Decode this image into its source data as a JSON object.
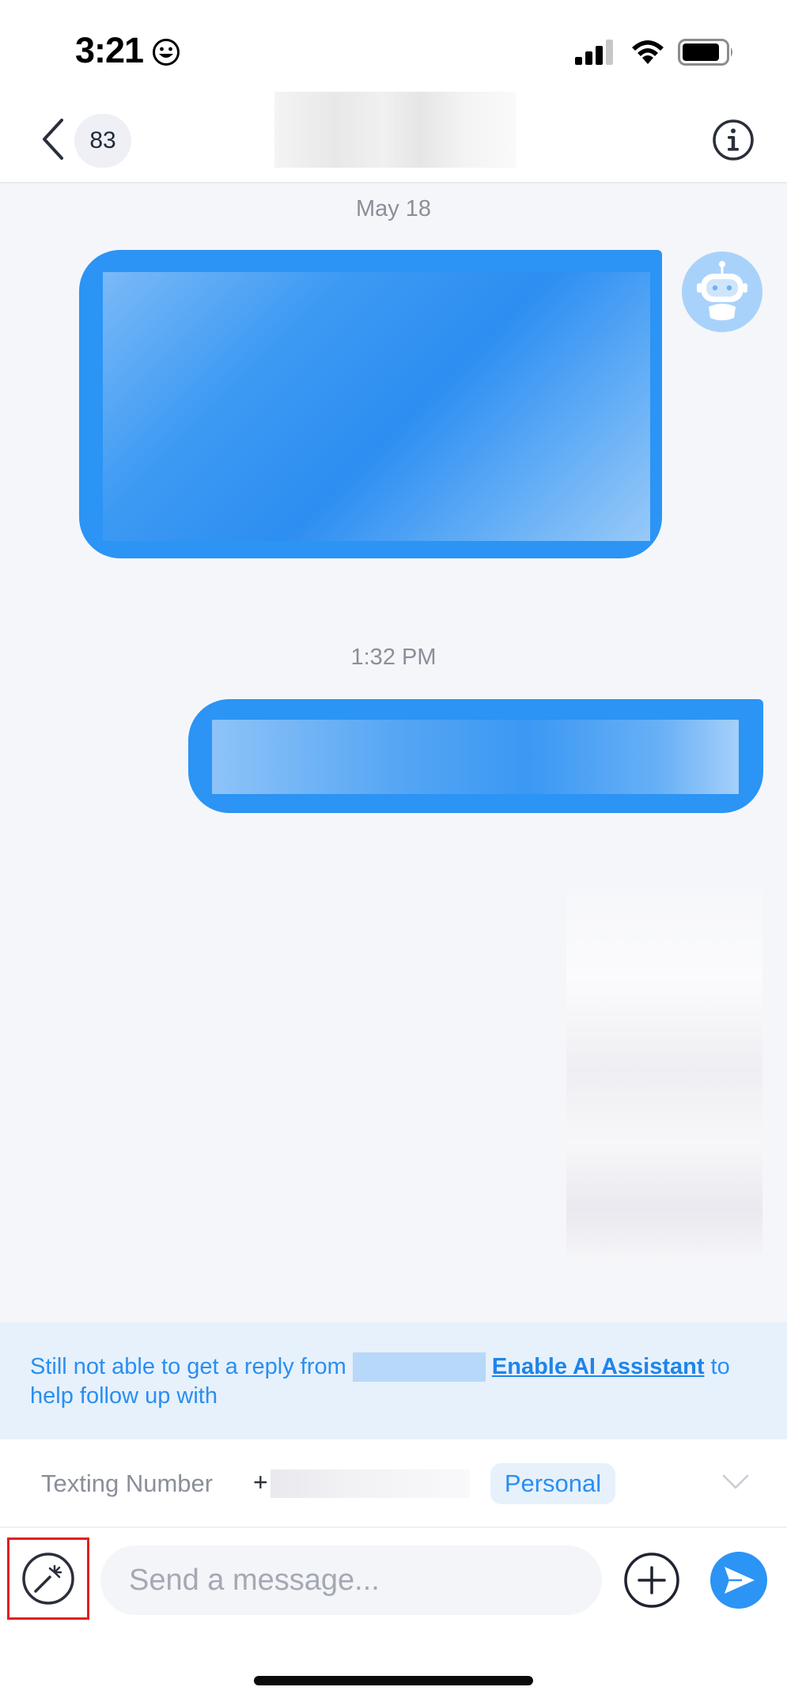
{
  "status_bar": {
    "time": "3:21"
  },
  "header": {
    "unread_count": "83"
  },
  "chat": {
    "date_1": "May 18",
    "date_2": "1:32 PM"
  },
  "ai_banner": {
    "text_prefix": "Still not able to get a reply from",
    "link_text": "Enable AI Assistant",
    "text_middle": " to help follow up with"
  },
  "texting_row": {
    "label": "Texting Number",
    "plus": "+",
    "badge": "Personal"
  },
  "composer": {
    "placeholder": "Send a message..."
  },
  "colors": {
    "accent": "#2b94f5",
    "banner_bg": "#e6f1fc",
    "highlight": "#e0201f"
  }
}
